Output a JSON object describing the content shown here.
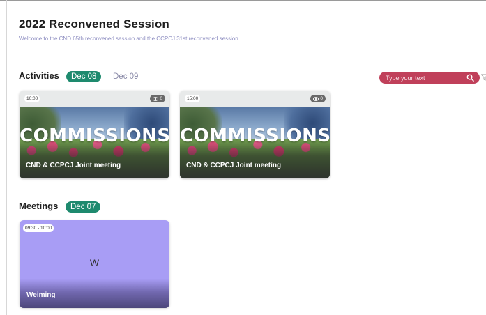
{
  "session": {
    "title": "2022 Reconvened Session",
    "subtitle": "Welcome to the CND 65th reconvened session and the CCPCJ 31st reconvened session ..."
  },
  "activities": {
    "label": "Activities",
    "dates": [
      {
        "label": "Dec 08",
        "active": true
      },
      {
        "label": "Dec 09",
        "active": false
      }
    ],
    "cards": [
      {
        "time": "10:00",
        "views": "0",
        "image_text": "COMMISSIONS",
        "title": "CND & CCPCJ Joint meeting"
      },
      {
        "time": "15:00",
        "views": "0",
        "image_text": "COMMISSIONS",
        "title": "CND & CCPCJ Joint meeting"
      }
    ]
  },
  "search": {
    "placeholder": "Type your text",
    "icon": "search-icon",
    "filter_icon": "filter-icon"
  },
  "meetings": {
    "label": "Meetings",
    "dates": [
      {
        "label": "Dec 07",
        "active": true
      }
    ],
    "cards": [
      {
        "time": "09:30 - 10:00",
        "initial": "W",
        "title": "Weiming"
      }
    ]
  },
  "colors": {
    "active_pill": "#1e8a6e",
    "search_bg": "#c0405a",
    "meeting_card": "#a89df5"
  }
}
